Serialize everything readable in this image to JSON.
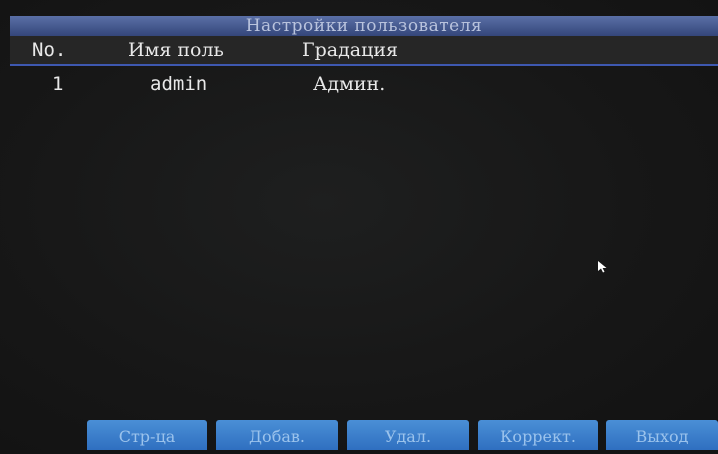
{
  "window": {
    "title": "Настройки пользователя"
  },
  "table": {
    "columns": [
      "No.",
      "Имя поль",
      "Градация"
    ],
    "rows": [
      {
        "no": "1",
        "name": "admin",
        "grade": "Админ."
      }
    ]
  },
  "buttons": {
    "page": "Стр-ца",
    "add": "Добав.",
    "delete": "Удал.",
    "edit": "Коррект.",
    "exit": "Выход"
  },
  "colors": {
    "title_bar": "#4a5e96",
    "header_underline": "#3e58b0",
    "button": "#3b7fcc"
  }
}
